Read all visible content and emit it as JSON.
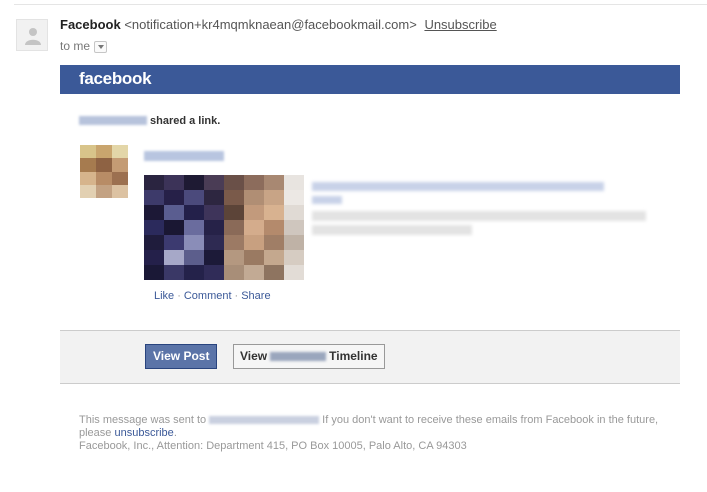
{
  "header": {
    "sender_name": "Facebook",
    "sender_email": "<notification+kr4mqmknaean@facebookmail.com>",
    "unsubscribe_label": "Unsubscribe",
    "to_label": "to me"
  },
  "banner": {
    "logo_text": "facebook"
  },
  "story": {
    "shared_text": "shared a link."
  },
  "actions": {
    "like": "Like",
    "comment": "Comment",
    "share": "Share"
  },
  "buttons": {
    "view_post": "View Post",
    "view_timeline_prefix": "View",
    "view_timeline_suffix": "Timeline"
  },
  "footer": {
    "line1_prefix": "This message was sent to",
    "line1_suffix": "If you don't want to receive these emails from Facebook in the future, please",
    "unsubscribe_link": "unsubscribe",
    "line1_end": ".",
    "address": "Facebook, Inc., Attention: Department 415, PO Box 10005, Palo Alto, CA 94303"
  },
  "colors": {
    "brand_blue": "#3b5998",
    "button_blue": "#5b74a8",
    "footer_text": "#999999"
  }
}
